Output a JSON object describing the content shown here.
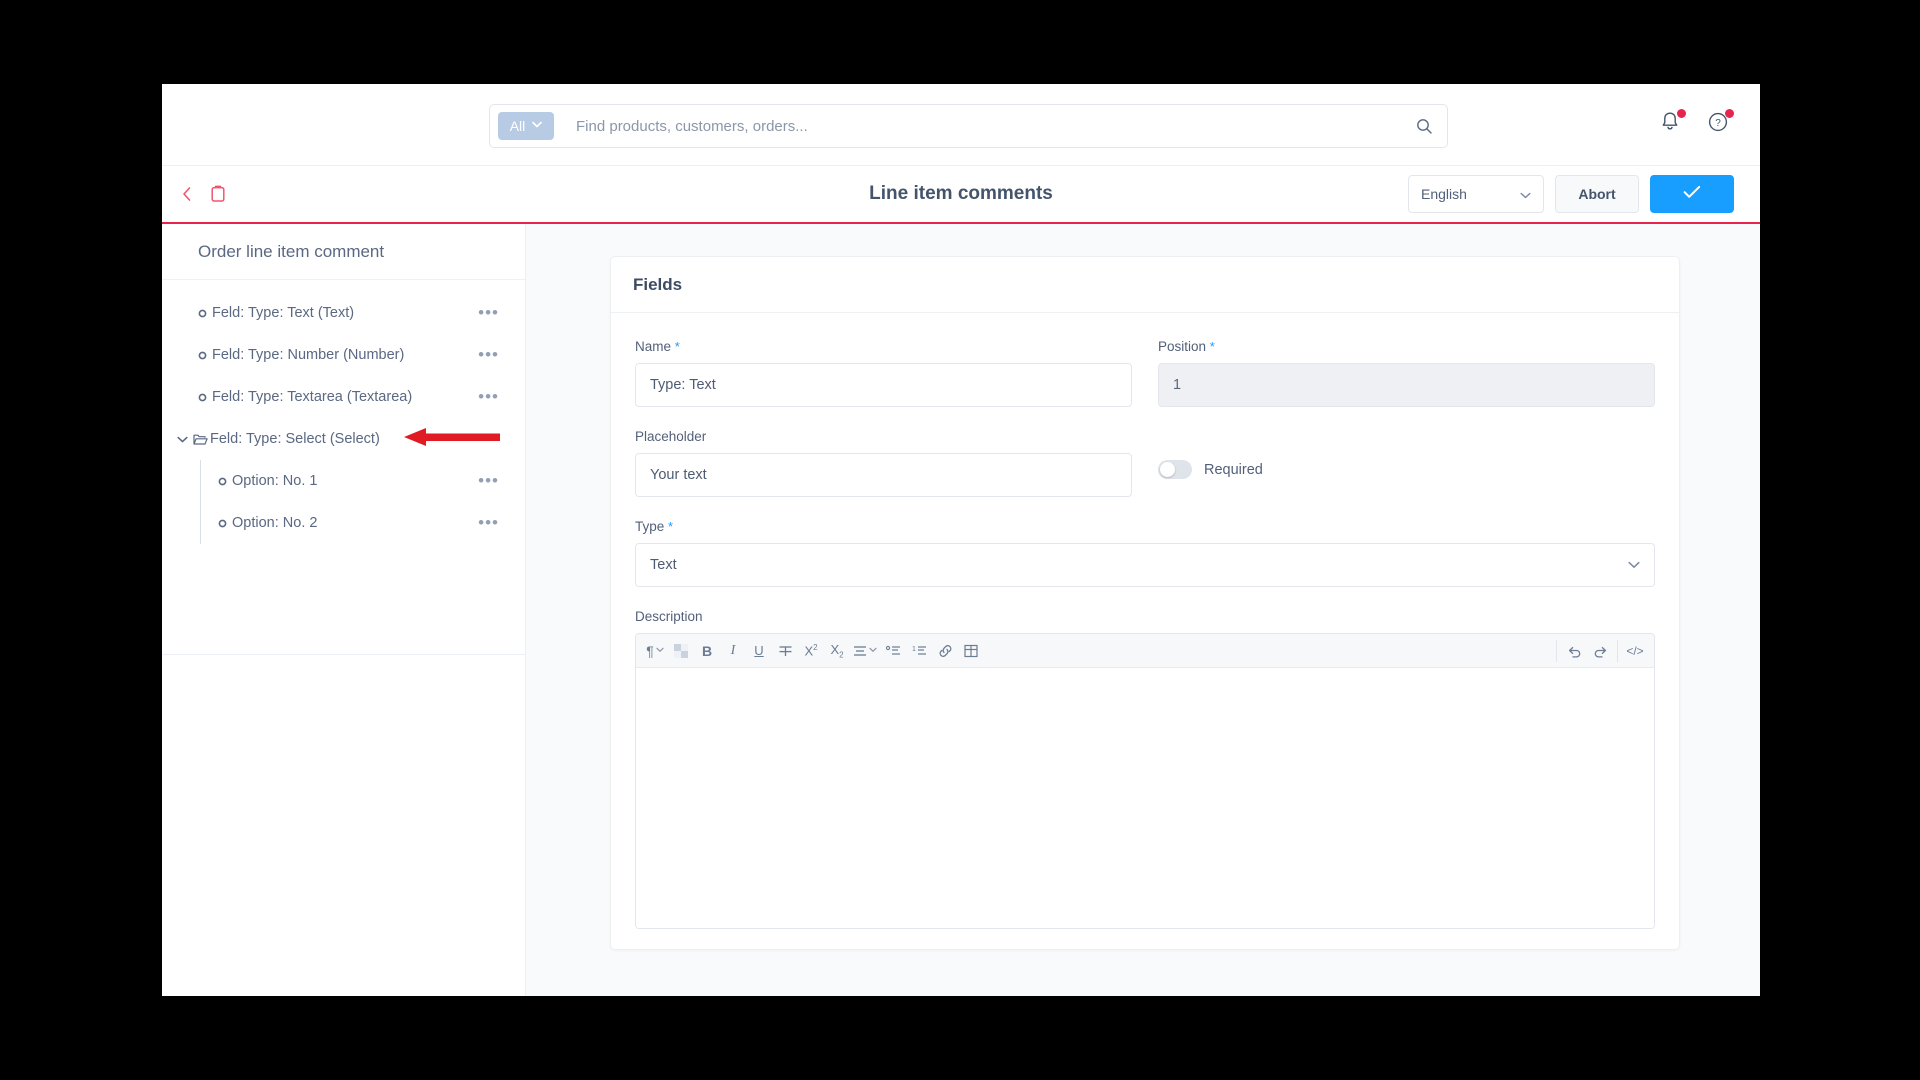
{
  "topbar": {
    "search": {
      "scope_label": "All",
      "scope_caret": "chevron-down",
      "placeholder": "Find products, customers, orders..."
    },
    "notifications_icon": "bell-icon",
    "help_icon": "help-circle-icon",
    "badge_color": "#e7254c"
  },
  "header": {
    "back_icon": "chevron-left-icon",
    "module_icon": "clipboard-icon",
    "title": "Line item comments",
    "language": "English",
    "abort_label": "Abort",
    "save_icon": "check-icon",
    "accent_color": "#e7254c",
    "primary_color": "#189eff"
  },
  "sidebar": {
    "title": "Order line item comment",
    "items": [
      {
        "label": "Feld: Type: Text (Text)",
        "level": 0,
        "icon": "node-dot-icon",
        "expandable": false,
        "menu": "•••",
        "selected": true
      },
      {
        "label": "Feld: Type: Number (Number)",
        "level": 0,
        "icon": "node-dot-icon",
        "expandable": false,
        "menu": "•••",
        "selected": false
      },
      {
        "label": "Feld: Type: Textarea (Textarea)",
        "level": 0,
        "icon": "node-dot-icon",
        "expandable": false,
        "menu": "•••",
        "selected": false
      },
      {
        "label": "Feld: Type: Select (Select)",
        "level": 0,
        "icon": "folder-open-icon",
        "expandable": true,
        "expanded": true,
        "menu": "•••",
        "selected": false
      },
      {
        "label": "Option: No. 1",
        "level": 1,
        "icon": "node-dot-icon",
        "expandable": false,
        "menu": "•••",
        "selected": false
      },
      {
        "label": "Option: No. 2",
        "level": 1,
        "icon": "node-dot-icon",
        "expandable": false,
        "menu": "•••",
        "selected": false
      }
    ]
  },
  "fields_card": {
    "title": "Fields",
    "name": {
      "label": "Name",
      "required_mark": "*",
      "value": "Type: Text"
    },
    "position": {
      "label": "Position",
      "required_mark": "*",
      "value": "1",
      "disabled": true
    },
    "placeholder_field": {
      "label": "Placeholder",
      "value": "Your text"
    },
    "required_toggle": {
      "label": "Required",
      "checked": false
    },
    "type": {
      "label": "Type",
      "required_mark": "*",
      "value": "Text",
      "caret": "chevron-down"
    },
    "description": {
      "label": "Description",
      "content": ""
    },
    "editor_toolbar": [
      {
        "name": "paragraph-style-icon",
        "glyph": "¶",
        "has_caret": true
      },
      {
        "name": "text-color-icon",
        "glyph": "▨",
        "has_caret": false
      },
      {
        "name": "bold-icon",
        "glyph": "B",
        "has_caret": false
      },
      {
        "name": "italic-icon",
        "glyph": "I",
        "has_caret": false
      },
      {
        "name": "underline-icon",
        "glyph": "U",
        "has_caret": false
      },
      {
        "name": "strikethrough-icon",
        "glyph": "S",
        "has_caret": false
      },
      {
        "name": "superscript-icon",
        "glyph": "X²",
        "has_caret": false
      },
      {
        "name": "subscript-icon",
        "glyph": "X₂",
        "has_caret": false
      },
      {
        "name": "align-icon",
        "glyph": "≡",
        "has_caret": true
      },
      {
        "name": "bullet-list-icon",
        "glyph": "•≡",
        "has_caret": false
      },
      {
        "name": "numbered-list-icon",
        "glyph": "1≡",
        "has_caret": false
      },
      {
        "name": "link-icon",
        "glyph": "🔗",
        "has_caret": false
      },
      {
        "name": "table-icon",
        "glyph": "⊞",
        "has_caret": false
      }
    ],
    "editor_toolbar_right": [
      {
        "name": "undo-icon",
        "glyph": "↶"
      },
      {
        "name": "redo-icon",
        "glyph": "↷"
      },
      {
        "name": "code-view-icon",
        "glyph": "</>"
      }
    ]
  },
  "annotation": {
    "arrow_color": "#e01b24",
    "points_to": "Feld: Type: Text (Text)"
  }
}
